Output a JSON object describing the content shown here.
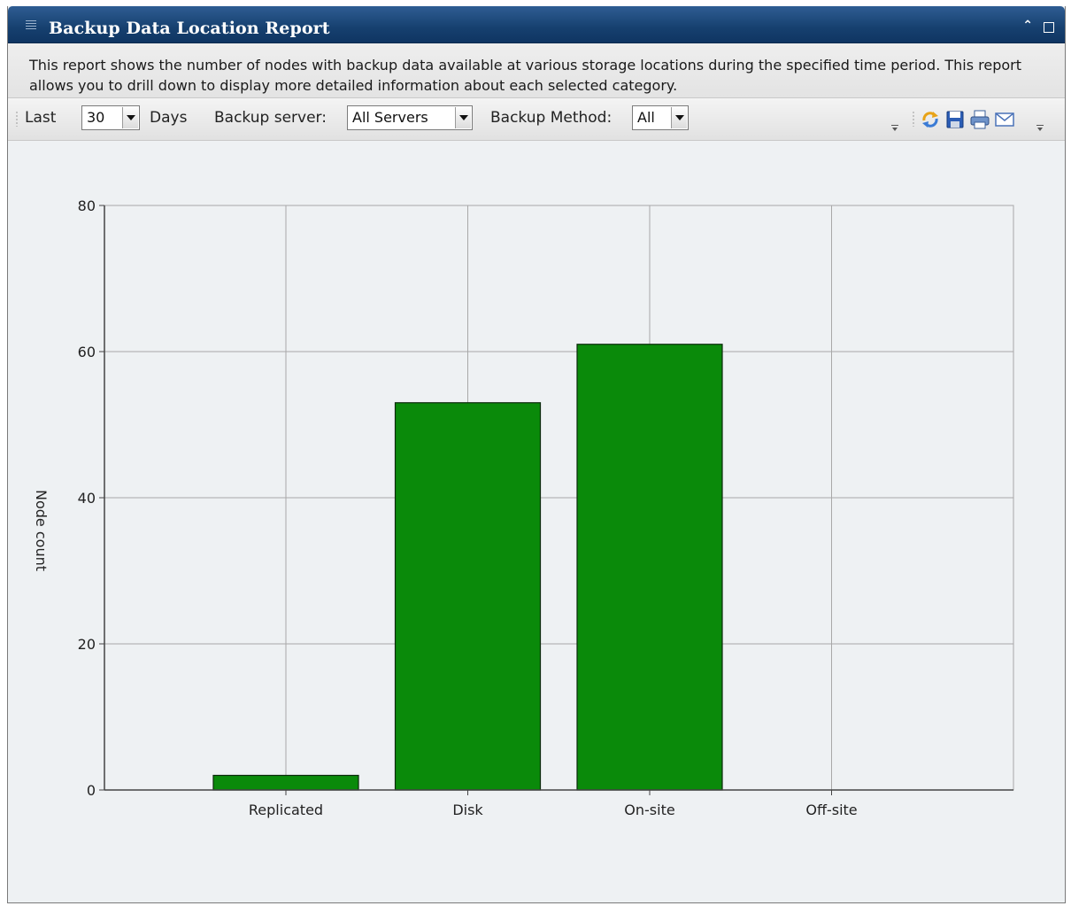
{
  "window": {
    "title": "Backup Data Location Report",
    "collapse_icon": "double-chevron-up-icon",
    "maximize_icon": "maximize-icon"
  },
  "description": "This report shows the number of nodes with backup data available at various storage locations during the specified time period. This report allows you to drill down to display more detailed information about each selected category.",
  "toolbar": {
    "last_label": "Last",
    "days_value": "30",
    "days_label": "Days",
    "server_label": "Backup server:",
    "server_value": "All Servers",
    "method_label": "Backup Method:",
    "method_value": "All",
    "icons": [
      "refresh-icon",
      "save-icon",
      "print-icon",
      "email-icon"
    ]
  },
  "colors": {
    "title_bar": "#16406f",
    "bar_fill": "#0a8a0a",
    "bar_stroke": "#0b2a0b",
    "grid": "#a8a8a8"
  },
  "chart_data": {
    "type": "bar",
    "categories": [
      "Replicated",
      "Disk",
      "On-site",
      "Off-site"
    ],
    "values": [
      2,
      53,
      61,
      0
    ],
    "ylabel": "Node count",
    "xlabel": "",
    "ylim": [
      0,
      80
    ],
    "yticks": [
      0,
      20,
      40,
      60,
      80
    ],
    "grid": true
  }
}
